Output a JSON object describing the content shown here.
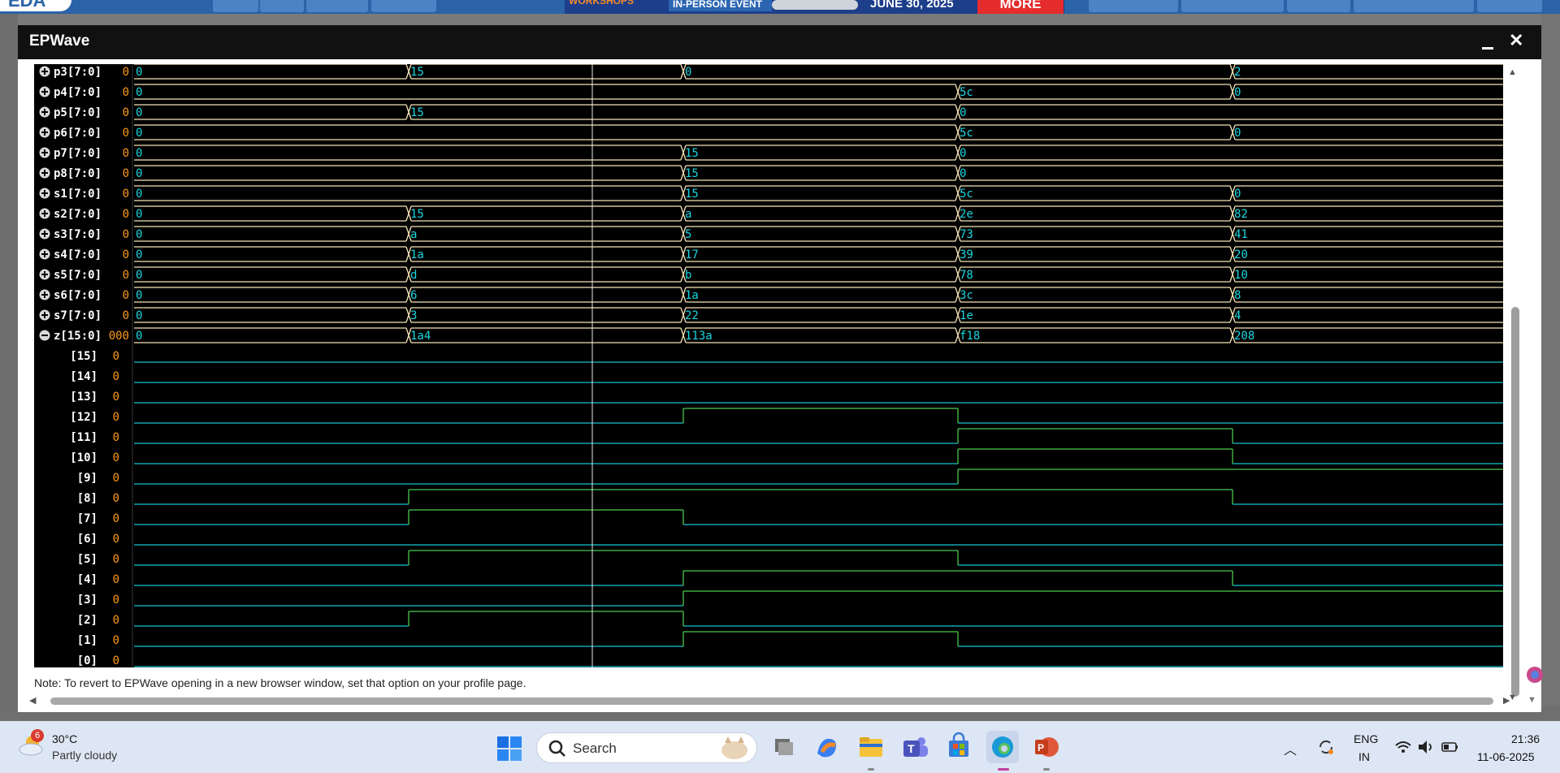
{
  "window": {
    "title": "EPWave",
    "note": "Note: To revert to EPWave opening in a new browser window, set that option on your profile page."
  },
  "bus_signals": [
    {
      "name": "p3[7:0]",
      "value": "0",
      "icon": "plus",
      "values": [
        "0",
        "15",
        "0",
        "",
        "2"
      ]
    },
    {
      "name": "p4[7:0]",
      "value": "0",
      "icon": "plus",
      "values": [
        "0",
        "",
        "",
        "5c",
        "0"
      ]
    },
    {
      "name": "p5[7:0]",
      "value": "0",
      "icon": "plus",
      "values": [
        "0",
        "15",
        "",
        "0",
        ""
      ]
    },
    {
      "name": "p6[7:0]",
      "value": "0",
      "icon": "plus",
      "values": [
        "0",
        "",
        "",
        "5c",
        "0"
      ]
    },
    {
      "name": "p7[7:0]",
      "value": "0",
      "icon": "plus",
      "values": [
        "0",
        "",
        "15",
        "0",
        ""
      ]
    },
    {
      "name": "p8[7:0]",
      "value": "0",
      "icon": "plus",
      "values": [
        "0",
        "",
        "15",
        "0",
        ""
      ]
    },
    {
      "name": "s1[7:0]",
      "value": "0",
      "icon": "plus",
      "values": [
        "0",
        "",
        "15",
        "5c",
        "0"
      ]
    },
    {
      "name": "s2[7:0]",
      "value": "0",
      "icon": "plus",
      "values": [
        "0",
        "15",
        "a",
        "2e",
        "82"
      ]
    },
    {
      "name": "s3[7:0]",
      "value": "0",
      "icon": "plus",
      "values": [
        "0",
        "a",
        "5",
        "73",
        "41"
      ]
    },
    {
      "name": "s4[7:0]",
      "value": "0",
      "icon": "plus",
      "values": [
        "0",
        "1a",
        "17",
        "39",
        "20"
      ]
    },
    {
      "name": "s5[7:0]",
      "value": "0",
      "icon": "plus",
      "values": [
        "0",
        "d",
        "b",
        "78",
        "10"
      ]
    },
    {
      "name": "s6[7:0]",
      "value": "0",
      "icon": "plus",
      "values": [
        "0",
        "6",
        "1a",
        "3c",
        "8"
      ]
    },
    {
      "name": "s7[7:0]",
      "value": "0",
      "icon": "plus",
      "values": [
        "0",
        "3",
        "22",
        "1e",
        "4"
      ]
    },
    {
      "name": "z[15:0]",
      "value": "000",
      "icon": "minus",
      "values": [
        "0",
        "1a4",
        "113a",
        "f18",
        "208"
      ]
    }
  ],
  "bit_signals": [
    {
      "name": "[15]",
      "value": "0",
      "levels": [
        0,
        0,
        0,
        0,
        0
      ]
    },
    {
      "name": "[14]",
      "value": "0",
      "levels": [
        0,
        0,
        0,
        0,
        0
      ]
    },
    {
      "name": "[13]",
      "value": "0",
      "levels": [
        0,
        0,
        0,
        0,
        0
      ]
    },
    {
      "name": "[12]",
      "value": "0",
      "levels": [
        0,
        0,
        1,
        0,
        0
      ]
    },
    {
      "name": "[11]",
      "value": "0",
      "levels": [
        0,
        0,
        0,
        1,
        0
      ]
    },
    {
      "name": "[10]",
      "value": "0",
      "levels": [
        0,
        0,
        0,
        1,
        0
      ]
    },
    {
      "name": "[9]",
      "value": "0",
      "levels": [
        0,
        0,
        0,
        1,
        1
      ]
    },
    {
      "name": "[8]",
      "value": "0",
      "levels": [
        0,
        1,
        1,
        1,
        0
      ]
    },
    {
      "name": "[7]",
      "value": "0",
      "levels": [
        0,
        1,
        0,
        0,
        0
      ]
    },
    {
      "name": "[6]",
      "value": "0",
      "levels": [
        0,
        0,
        0,
        0,
        0
      ]
    },
    {
      "name": "[5]",
      "value": "0",
      "levels": [
        0,
        1,
        1,
        0,
        0
      ]
    },
    {
      "name": "[4]",
      "value": "0",
      "levels": [
        0,
        0,
        1,
        1,
        0
      ]
    },
    {
      "name": "[3]",
      "value": "0",
      "levels": [
        0,
        0,
        1,
        1,
        1
      ]
    },
    {
      "name": "[2]",
      "value": "0",
      "levels": [
        0,
        1,
        0,
        0,
        0
      ]
    },
    {
      "name": "[1]",
      "value": "0",
      "levels": [
        0,
        0,
        1,
        0,
        0
      ]
    },
    {
      "name": "[0]",
      "value": "0",
      "levels": [
        0,
        0,
        0,
        0,
        0
      ]
    }
  ],
  "colors": {
    "bus_line": "#f4e3b6",
    "value_text": "#19d6e0",
    "init_value": "#ff9a1a",
    "low": "#17c3cf",
    "high": "#4cc94c",
    "marker": "#e8e8e8",
    "sig_name": "#ffffff",
    "bg": "#000000"
  },
  "background_page": {
    "banner_left": "WORKSHOPS",
    "banner_event": "IN-PERSON EVENT",
    "banner_date": "JUNE 30, 2025",
    "banner_more": "MORE",
    "logo": "EDA"
  },
  "taskbar": {
    "weather_badge": "6",
    "temperature": "30°C",
    "condition": "Partly cloudy",
    "search_label": "Search",
    "lang_line1": "ENG",
    "lang_line2": "IN",
    "time": "21:36",
    "date": "11-06-2025"
  }
}
